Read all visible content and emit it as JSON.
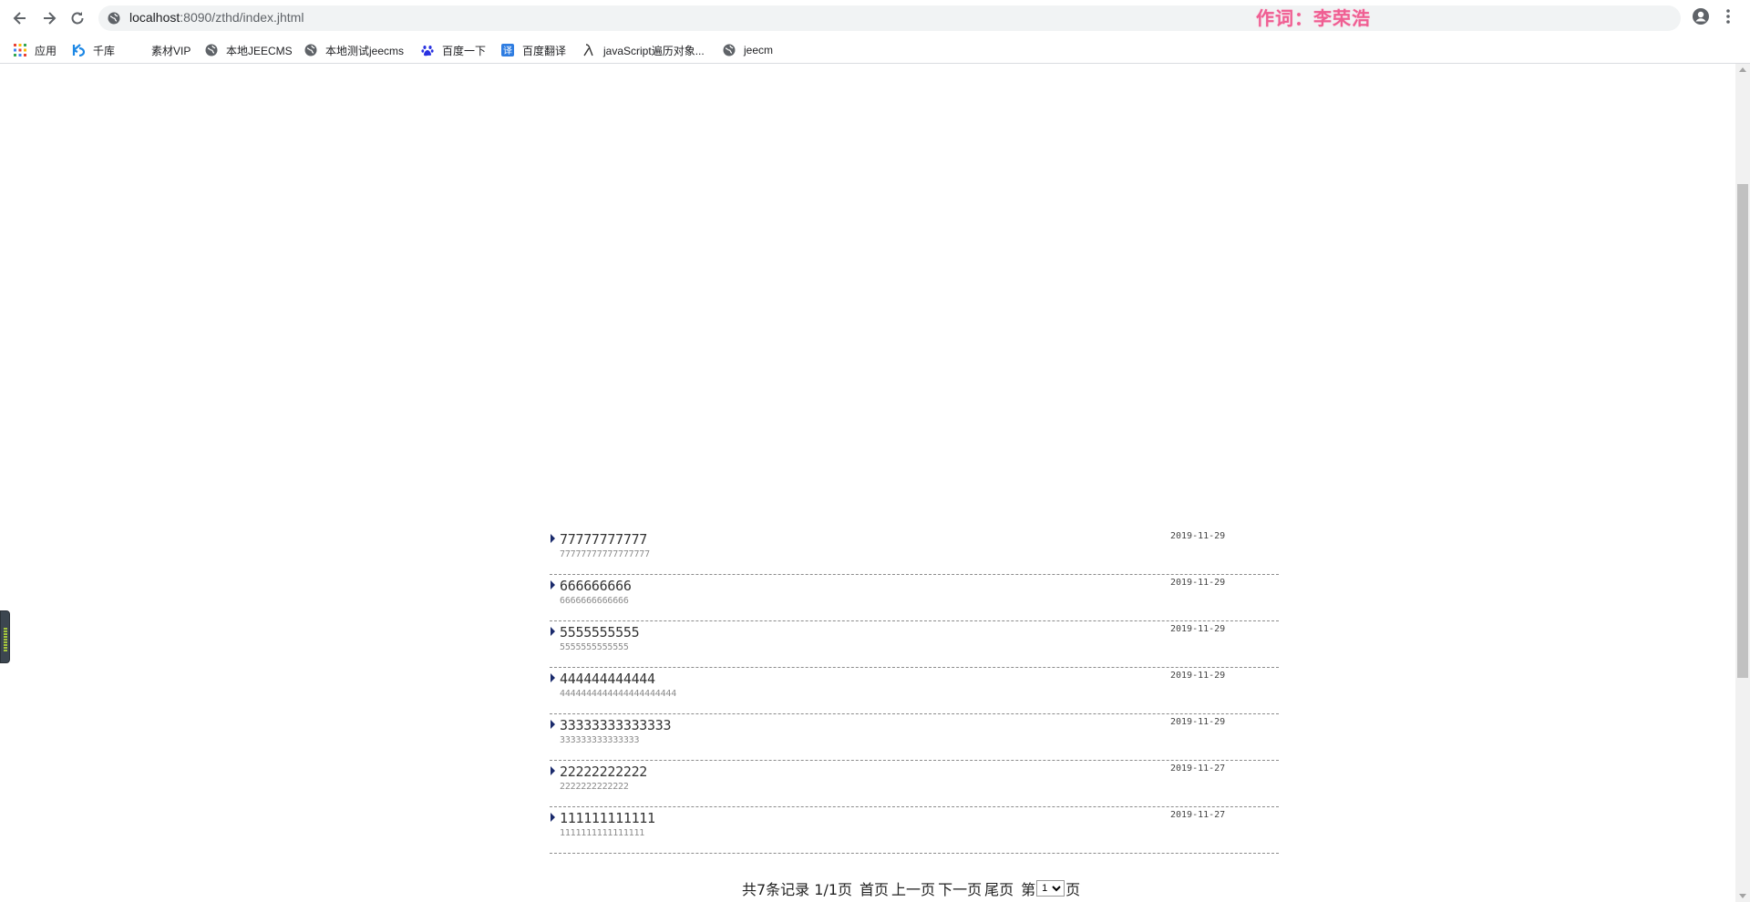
{
  "browser": {
    "url_host": "localhost",
    "url_path": ":8090/zthd/index.jhtml",
    "watermark": "作词：李荣浩",
    "bookmarks": [
      {
        "label": "应用",
        "icon": "apps-grid-icon"
      },
      {
        "label": "千库",
        "icon": "qianku-icon"
      },
      {
        "label": "素材VIP",
        "icon": "blank-icon"
      },
      {
        "label": "本地JEECMS",
        "icon": "globe-icon"
      },
      {
        "label": "本地测试jeecms",
        "icon": "globe-icon"
      },
      {
        "label": "百度一下",
        "icon": "baidu-paw-icon"
      },
      {
        "label": "百度翻译",
        "icon": "translate-icon"
      },
      {
        "label": "javaScript遍历对象...",
        "icon": "lambda-icon"
      },
      {
        "label": "jeecm",
        "icon": "globe-icon"
      }
    ]
  },
  "list": {
    "items": [
      {
        "title": "77777777777",
        "subtitle": "77777777777777777",
        "date": "2019-11-29"
      },
      {
        "title": "666666666",
        "subtitle": "6666666666666",
        "date": "2019-11-29"
      },
      {
        "title": "5555555555",
        "subtitle": "5555555555555",
        "date": "2019-11-29"
      },
      {
        "title": "444444444444",
        "subtitle": "4444444444444444444444",
        "date": "2019-11-29"
      },
      {
        "title": "33333333333333",
        "subtitle": "333333333333333",
        "date": "2019-11-29"
      },
      {
        "title": "22222222222",
        "subtitle": "2222222222222",
        "date": "2019-11-27"
      },
      {
        "title": "111111111111",
        "subtitle": "1111111111111111",
        "date": "2019-11-27"
      }
    ]
  },
  "pager": {
    "summary": "共7条记录 1/1页",
    "first": "首页",
    "prev": "上一页",
    "next": "下一页",
    "last": "尾页",
    "goto_prefix": "第",
    "goto_suffix": "页",
    "page_options": [
      "1"
    ],
    "selected_page": "1"
  }
}
